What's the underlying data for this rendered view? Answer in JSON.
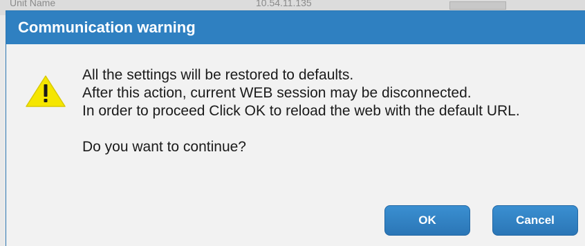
{
  "background": {
    "column1": "Unit Name",
    "column2": "10.54.11.135"
  },
  "dialog": {
    "title": "Communication warning",
    "icon": "warning-triangle-icon",
    "message_lines": [
      "All the settings will be restored to defaults.",
      "After this action, current WEB session may be disconnected.",
      "In order to proceed Click OK to reload the web with the default URL."
    ],
    "question": "Do you want to continue?",
    "ok_label": "OK",
    "cancel_label": "Cancel"
  },
  "colors": {
    "titlebar": "#2f80c1",
    "button": "#2f80c1",
    "warning_fill": "#f5e600",
    "dialog_body": "#f2f2f2"
  }
}
